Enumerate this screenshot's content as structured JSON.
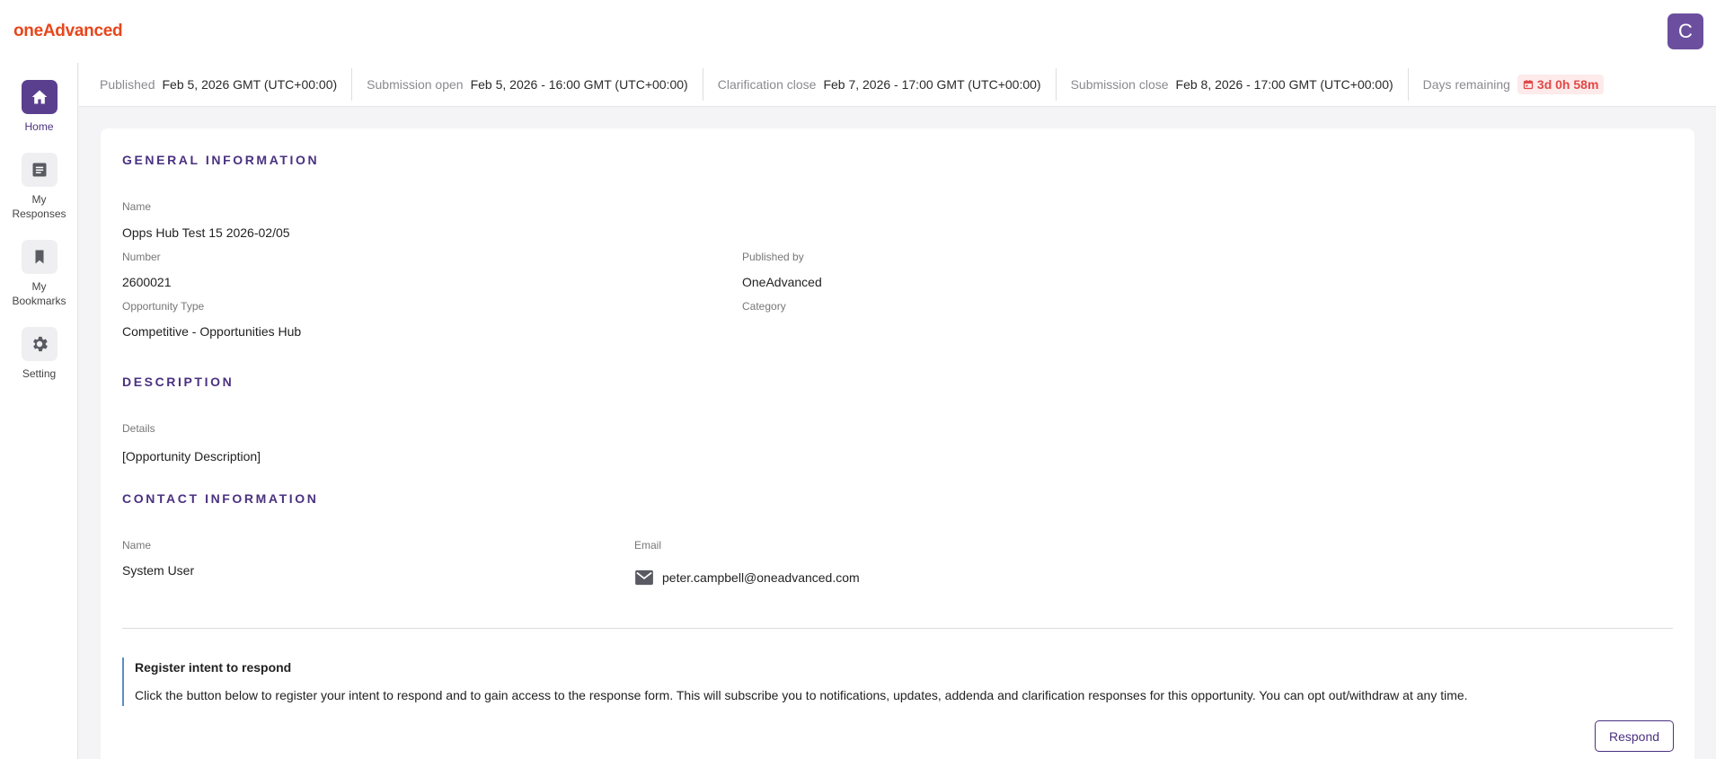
{
  "header": {
    "logo_text": "oneAdvanced",
    "avatar_initial": "C"
  },
  "sidebar": {
    "items": [
      {
        "label": "Home",
        "icon": "home-icon",
        "active": true
      },
      {
        "label": "My\nResponses",
        "icon": "document-icon"
      },
      {
        "label": "My\nBookmarks",
        "icon": "bookmark-icon"
      },
      {
        "label": "Setting",
        "icon": "gear-icon"
      }
    ]
  },
  "info_bar": {
    "published_label": "Published",
    "published_value": "Feb 5, 2026 GMT (UTC+00:00)",
    "submission_open_label": "Submission open",
    "submission_open_value": "Feb 5, 2026 - 16:00 GMT (UTC+00:00)",
    "clarification_close_label": "Clarification close",
    "clarification_close_value": "Feb 7, 2026 - 17:00 GMT (UTC+00:00)",
    "submission_close_label": "Submission close",
    "submission_close_value": "Feb 8, 2026 - 17:00 GMT (UTC+00:00)",
    "days_remaining_label": "Days remaining",
    "days_remaining_value": "3d 0h 58m"
  },
  "general": {
    "title": "GENERAL INFORMATION",
    "name_label": "Name",
    "name_value": "Opps Hub Test 15 2026-02/05",
    "number_label": "Number",
    "number_value": "2600021",
    "published_by_label": "Published by",
    "published_by_value": "OneAdvanced",
    "type_label": "Opportunity Type",
    "type_value": "Competitive - Opportunities Hub",
    "category_label": "Category"
  },
  "description": {
    "title": "DESCRIPTION",
    "details_label": "Details",
    "details_value": "[Opportunity Description]"
  },
  "contact": {
    "title": "CONTACT INFORMATION",
    "name_label": "Name",
    "name_value": "System User",
    "email_label": "Email",
    "email_value": "peter.campbell@oneadvanced.com"
  },
  "intent": {
    "title": "Register intent to respond",
    "text": "Click the button below to register your intent to respond and to gain access to the response form. This will subscribe you to notifications, updates, addenda and clarification responses for this opportunity. You can opt out/withdraw at any time.",
    "button_label": "Respond"
  },
  "colors": {
    "brand_orange": "#e8461c",
    "accent_purple": "#4a3180",
    "badge_red": "#e14848"
  }
}
